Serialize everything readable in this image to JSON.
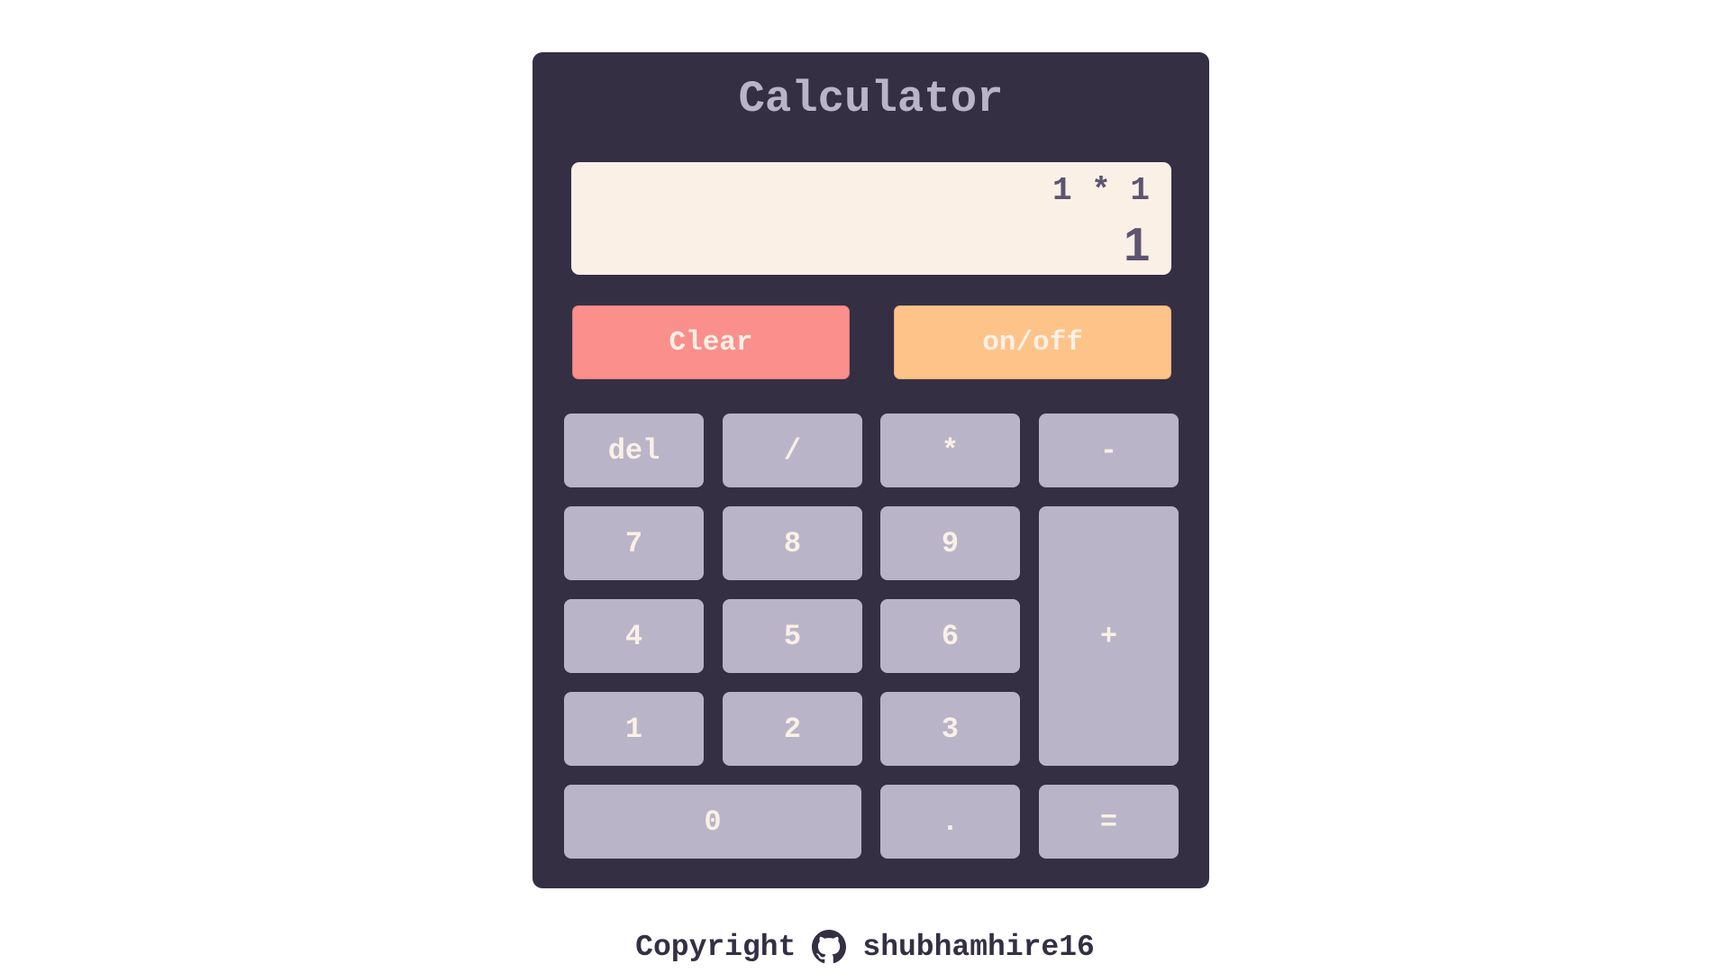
{
  "calculator": {
    "title": "Calculator",
    "display": {
      "expression": "1 * 1",
      "result": "1"
    },
    "controls": {
      "clear_label": "Clear",
      "onoff_label": "on/off"
    },
    "keys": {
      "del": "del",
      "divide": "/",
      "multiply": "*",
      "subtract": "-",
      "seven": "7",
      "eight": "8",
      "nine": "9",
      "add": "+",
      "four": "4",
      "five": "5",
      "six": "6",
      "one": "1",
      "two": "2",
      "three": "3",
      "zero": "0",
      "decimal": ".",
      "equals": "="
    }
  },
  "footer": {
    "copyright_label": "Copyright",
    "github_icon": "github-icon",
    "username": "shubhamhire16"
  },
  "colors": {
    "panel": "#352f44",
    "display_bg": "#faf0e6",
    "display_text": "#5c5470",
    "key_bg": "#b9b4c7",
    "key_text": "#faf0e6",
    "clear_bg": "#fa8f8c",
    "onoff_bg": "#fec389"
  }
}
